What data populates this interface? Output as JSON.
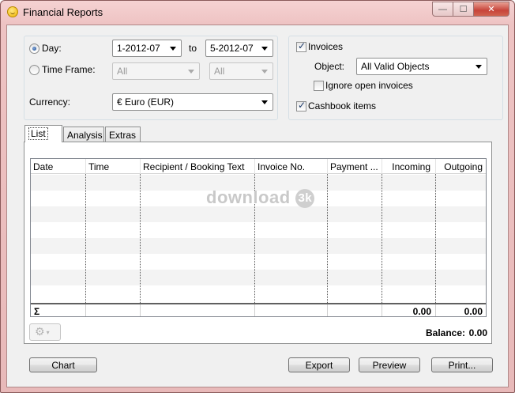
{
  "window": {
    "title": "Financial Reports",
    "caption": {
      "minimize": "—",
      "maximize": "☐",
      "close": "✕"
    }
  },
  "filters": {
    "day": {
      "label": "Day:",
      "selected": true,
      "from": "1-2012-07",
      "to_label": "to",
      "to": "5-2012-07"
    },
    "time_frame": {
      "label": "Time Frame:",
      "selected": false,
      "from": "All",
      "to": "All"
    },
    "currency": {
      "label": "Currency:",
      "value": "€ Euro (EUR)"
    }
  },
  "options": {
    "invoices": {
      "label": "Invoices",
      "checked": true
    },
    "object": {
      "label": "Object:",
      "value": "All Valid Objects"
    },
    "ignore_open": {
      "label": "Ignore open invoices",
      "checked": false
    },
    "cashbook": {
      "label": "Cashbook items",
      "checked": true
    }
  },
  "tabs": [
    {
      "label": "List",
      "active": true
    },
    {
      "label": "Analysis",
      "active": false
    },
    {
      "label": "Extras",
      "active": false
    }
  ],
  "table": {
    "columns": [
      "Date",
      "Time",
      "Recipient / Booking Text",
      "Invoice No.",
      "Payment ...",
      "Incoming",
      "Outgoing"
    ],
    "rows": [],
    "footer": {
      "sigma": "Σ",
      "incoming_total": "0.00",
      "outgoing_total": "0.00"
    }
  },
  "watermark": {
    "text": "download",
    "badge": "3k"
  },
  "balance": {
    "label": "Balance:",
    "value": "0.00"
  },
  "buttons": {
    "chart": "Chart",
    "export": "Export",
    "preview": "Preview",
    "print": "Print..."
  },
  "icons": {
    "gear": "⚙",
    "dropdown": "▾"
  }
}
